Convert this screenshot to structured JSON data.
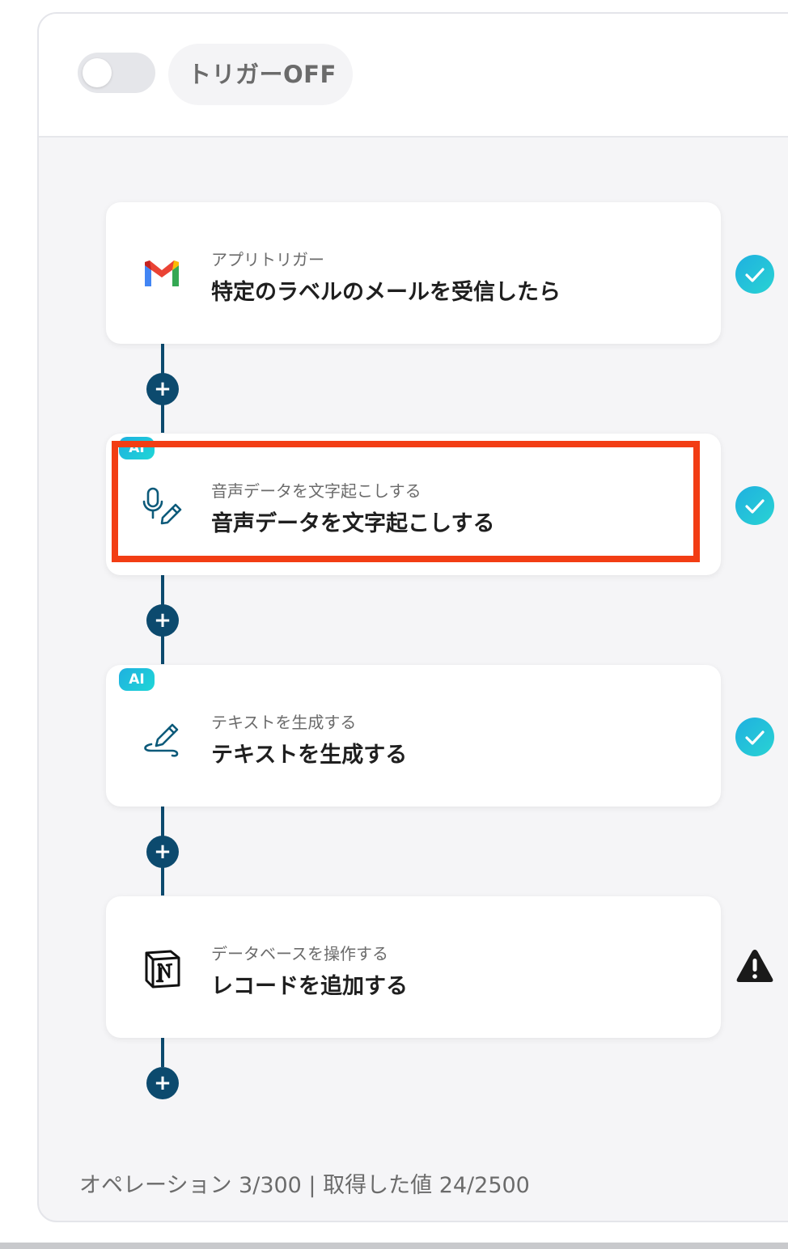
{
  "header": {
    "toggle_state": "off",
    "trigger_label": "トリガーOFF"
  },
  "steps": [
    {
      "icon": "gmail-icon",
      "subtitle": "アプリトリガー",
      "title": "特定のラベルのメールを受信したら",
      "ai": false,
      "status": "complete"
    },
    {
      "icon": "microphone-pen-icon",
      "subtitle": "音声データを文字起こしする",
      "title": "音声データを文字起こしする",
      "ai": true,
      "ai_label": "AI",
      "status": "complete",
      "highlighted": true
    },
    {
      "icon": "pen-scribble-icon",
      "subtitle": "テキストを生成する",
      "title": "テキストを生成する",
      "ai": true,
      "ai_label": "AI",
      "status": "complete"
    },
    {
      "icon": "notion-icon",
      "subtitle": "データベースを操作する",
      "title": "レコードを追加する",
      "ai": false,
      "status": "warning"
    }
  ],
  "add_step_symbol": "+",
  "footer": {
    "usage_text": "オペレーション 3/300 | 取得した値 24/2500"
  },
  "colors": {
    "connector": "#0c4a6e",
    "check_start": "#1fb0e0",
    "check_end": "#29d3d3",
    "highlight": "#f23d14",
    "warning": "#1a1a1a"
  }
}
